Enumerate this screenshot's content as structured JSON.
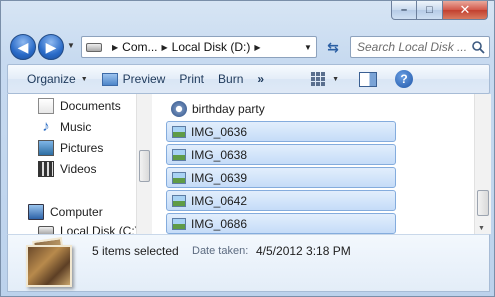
{
  "window": {
    "minimize_glyph": "–",
    "maximize_glyph": "□",
    "close_glyph": "✕"
  },
  "navigation": {
    "back_glyph": "◀",
    "forward_glyph": "▶",
    "address_segments": [
      "Com...",
      "Local Disk (D:)"
    ],
    "search_placeholder": "Search Local Disk ..."
  },
  "toolbar": {
    "organize": "Organize",
    "preview": "Preview",
    "print": "Print",
    "burn": "Burn",
    "more": "»"
  },
  "nav_pane": {
    "items": [
      {
        "label": "Documents",
        "icon": "documents-icon"
      },
      {
        "label": "Music",
        "icon": "music-icon"
      },
      {
        "label": "Pictures",
        "icon": "pictures-icon"
      },
      {
        "label": "Videos",
        "icon": "videos-icon"
      }
    ],
    "computer": {
      "label": "Computer",
      "icon": "computer-icon"
    },
    "local_disk": {
      "label": "Local Disk (C:)",
      "icon": "drive-icon"
    }
  },
  "files": {
    "folder": {
      "label": "birthday party"
    },
    "items": [
      {
        "label": "IMG_0636",
        "selected": true
      },
      {
        "label": "IMG_0638",
        "selected": true
      },
      {
        "label": "IMG_0639",
        "selected": true
      },
      {
        "label": "IMG_0642",
        "selected": true
      },
      {
        "label": "IMG_0686",
        "selected": true
      }
    ]
  },
  "details": {
    "selection_count": "5 items selected",
    "date_label": "Date taken:",
    "date_value": "4/5/2012 3:18 PM"
  },
  "colors": {
    "selection_fill": "#cfe1f8",
    "selection_border": "#84acdd",
    "chrome": "#bcd2ec"
  }
}
